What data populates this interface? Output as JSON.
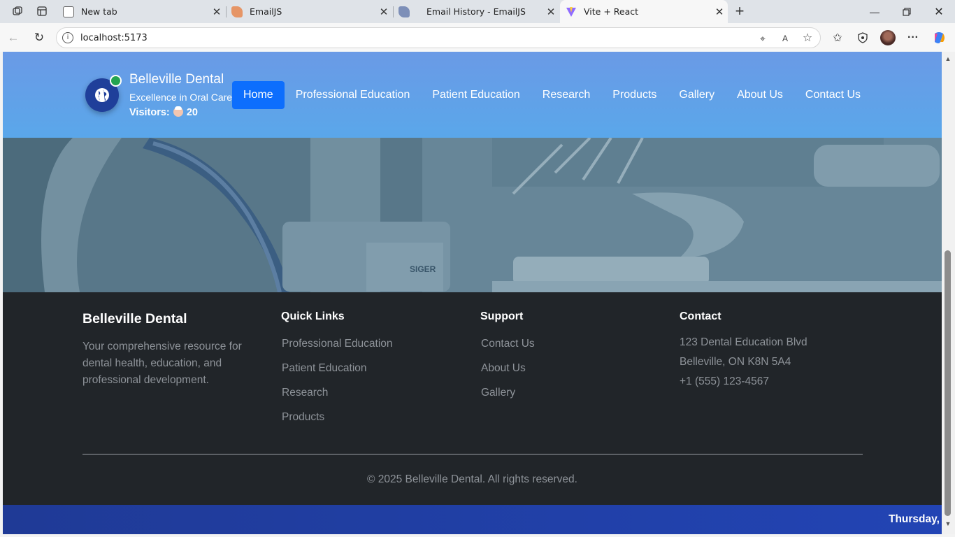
{
  "browser": {
    "tabs": [
      {
        "title": "New tab",
        "active": false
      },
      {
        "title": "EmailJS",
        "active": false
      },
      {
        "title": "Email History - EmailJS",
        "active": false
      },
      {
        "title": "Vite + React",
        "active": true
      }
    ],
    "url": "localhost:5173"
  },
  "header": {
    "brand_name": "Belleville Dental",
    "tagline": "Excellence in Oral Care",
    "visitors_label": "Visitors:",
    "visitors_count": "20",
    "nav": [
      {
        "label": "Home",
        "active": true
      },
      {
        "label": "Professional Education"
      },
      {
        "label": "Patient Education"
      },
      {
        "label": "Research"
      },
      {
        "label": "Products"
      },
      {
        "label": "Gallery"
      },
      {
        "label": "About Us"
      },
      {
        "label": "Contact Us"
      }
    ]
  },
  "footer": {
    "brand": {
      "title": "Belleville Dental",
      "description": "Your comprehensive resource for dental health, education, and professional development."
    },
    "quick_links": {
      "heading": "Quick Links",
      "items": [
        "Professional Education",
        "Patient Education",
        "Research",
        "Products"
      ]
    },
    "support": {
      "heading": "Support",
      "items": [
        "Contact Us",
        "About Us",
        "Gallery"
      ]
    },
    "contact": {
      "heading": "Contact",
      "lines": [
        "123 Dental Education Blvd",
        "Belleville, ON K8N 5A4",
        "+1 (555) 123-4567"
      ]
    },
    "copyright": "© 2025 Belleville Dental. All rights reserved."
  },
  "bottom_bar": {
    "date_text": "Thursday, :"
  },
  "colors": {
    "header_gradient_top": "#6a9ae6",
    "nav_active": "#0d6efd",
    "footer_bg": "#212529",
    "footer_muted": "#8e9399",
    "bottom_bar": "#2244b4",
    "online_dot": "#23a451"
  }
}
